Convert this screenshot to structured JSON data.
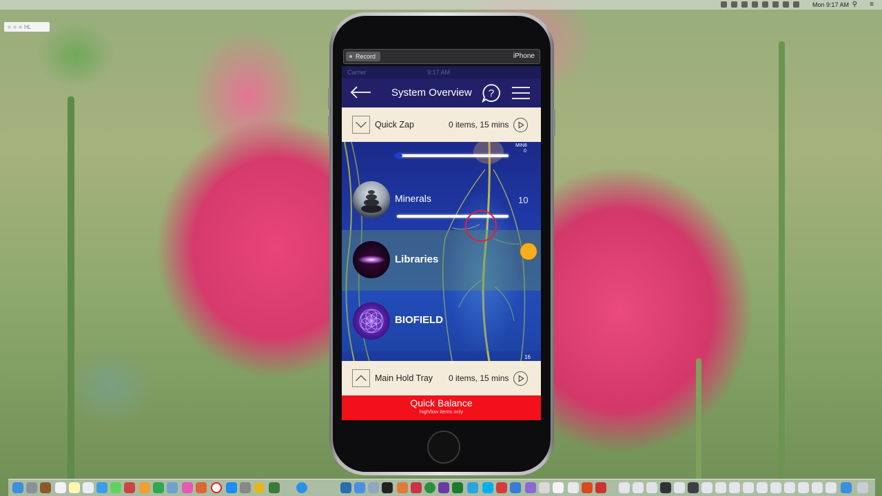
{
  "menubar": {
    "clock": "Mon 9:17 AM"
  },
  "desktop_window": {
    "label": "HL"
  },
  "recorder": {
    "record_label": "Record",
    "device_label": "iPhone"
  },
  "app": {
    "statusbar": {
      "carrier": "Carrier",
      "time": "9:17 AM"
    },
    "nav": {
      "title": "System Overview",
      "icons": [
        "back-arrow-icon",
        "help-icon",
        "menu-icon"
      ]
    },
    "quick_zap": {
      "label": "Quick Zap",
      "count": "0 items, 15 mins"
    },
    "rows": [
      {
        "label": "",
        "slider_percent": 0
      },
      {
        "label": "Minerals",
        "value": "10",
        "slider_percent": 0
      },
      {
        "label": "Libraries"
      },
      {
        "label": "BIOFIELD"
      }
    ],
    "min_label": "MIN",
    "min_value_top": "8",
    "min_value_bottom": "0",
    "scroll_index": "16",
    "main_hold_tray": {
      "label": "Main Hold Tray",
      "count": "0 items, 15 mins"
    },
    "quick_balance": {
      "title": "Quick Balance",
      "subtitle": "high/low items only"
    }
  },
  "colors": {
    "nav_bg": "#23206a",
    "tray_bg": "#f5ebdb",
    "quick_balance_bg": "#f2101a",
    "orange_indicator": "#f6ae1a",
    "cursor_ring": "#e0203a"
  }
}
